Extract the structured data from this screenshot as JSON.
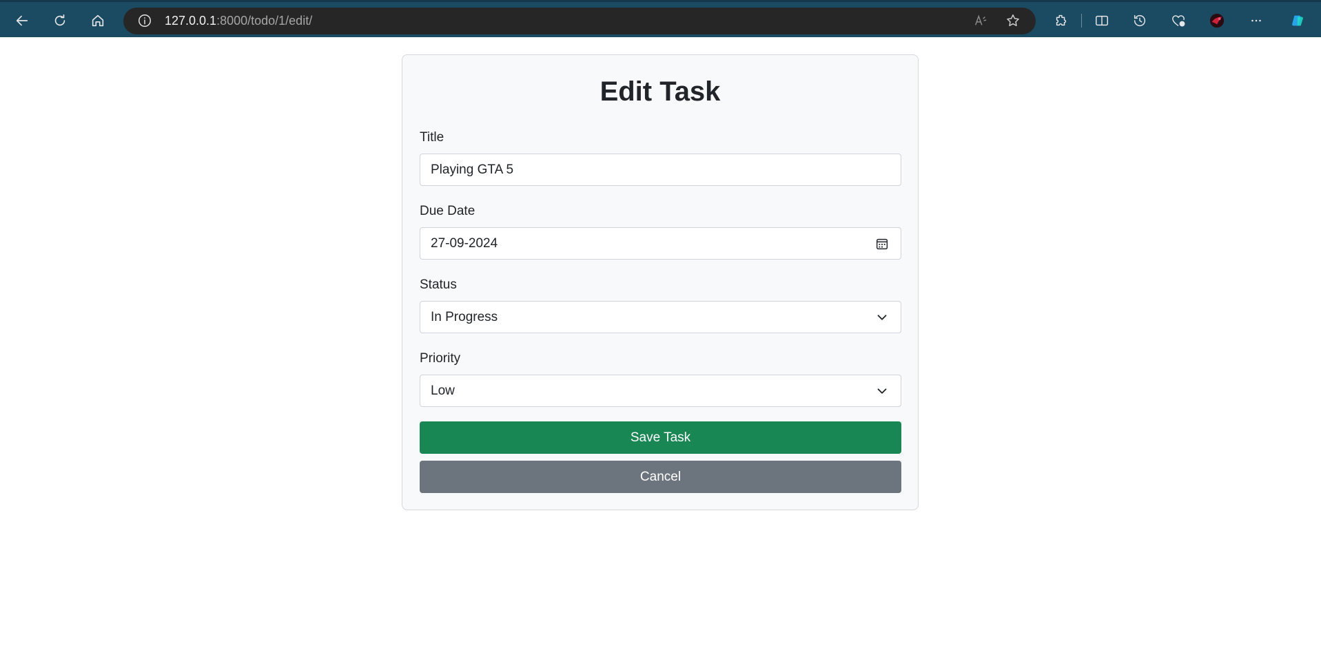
{
  "browser": {
    "url_host": "127.0.0.1",
    "url_path": ":8000/todo/1/edit/"
  },
  "form": {
    "heading": "Edit Task",
    "title": {
      "label": "Title",
      "value": "Playing GTA 5"
    },
    "due_date": {
      "label": "Due Date",
      "value": "27-09-2024"
    },
    "status": {
      "label": "Status",
      "value": "In Progress"
    },
    "priority": {
      "label": "Priority",
      "value": "Low"
    },
    "save_label": "Save Task",
    "cancel_label": "Cancel"
  },
  "colors": {
    "toolbar": "#1b4a63",
    "save": "#198754",
    "cancel": "#6c757d",
    "card": "#f8f9fa"
  }
}
